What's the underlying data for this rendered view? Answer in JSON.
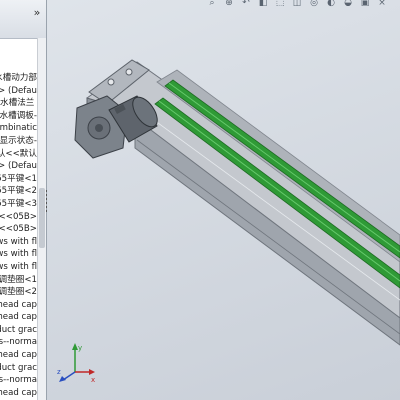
{
  "panel": {
    "collapse_glyph": "»",
    "tree_items": [
      "水槽动力部",
      "·> (Defau",
      "水槽法兰",
      "水槽调板-",
      "ombinatic",
      "显示状态-",
      "认<<默认",
      "·> (Defau",
      "55平键<1",
      "55平键<2",
      "55平键<3",
      "3<<05B>",
      "3<<05B>",
      "ws with fl",
      "ws with fl",
      "ws with fl",
      "调垫圈<1",
      "调垫圈<2",
      "head cap",
      "head cap",
      "duct grac",
      "s--norma",
      "head cap",
      "duct grac",
      "s--norma",
      "head cap"
    ]
  },
  "viewport": {
    "toolbar_icons": [
      "zoom-fit-icon",
      "zoom-area-icon",
      "previous-view-icon",
      "section-view-icon",
      "view-orientation-icon",
      "display-style-icon",
      "hide-show-icon",
      "appearance-icon",
      "scene-icon",
      "view-settings-icon",
      "close-icon"
    ],
    "colors": {
      "background": "#d3d9e1",
      "rail": "#b7bcc3",
      "belt": "#2f9a36",
      "motor": "#5e646c",
      "gearbox": "#7c838b"
    },
    "triad": {
      "x_label": "x",
      "y_label": "y",
      "z_label": "z"
    }
  }
}
